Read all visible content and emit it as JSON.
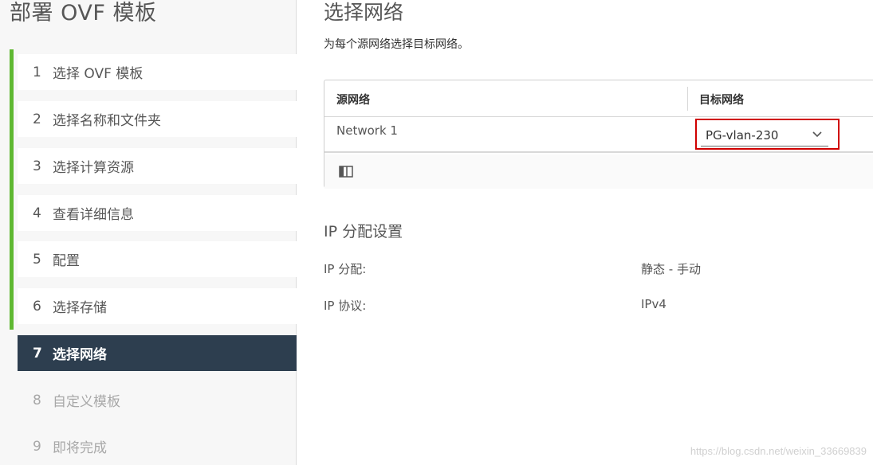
{
  "wizard": {
    "title": "部署 OVF 模板",
    "steps": [
      {
        "num": "1",
        "label": "选择 OVF 模板"
      },
      {
        "num": "2",
        "label": "选择名称和文件夹"
      },
      {
        "num": "3",
        "label": "选择计算资源"
      },
      {
        "num": "4",
        "label": "查看详细信息"
      },
      {
        "num": "5",
        "label": "配置"
      },
      {
        "num": "6",
        "label": "选择存储"
      },
      {
        "num": "7",
        "label": "选择网络"
      },
      {
        "num": "8",
        "label": "自定义模板"
      },
      {
        "num": "9",
        "label": "即将完成"
      }
    ]
  },
  "main": {
    "title": "选择网络",
    "description": "为每个源网络选择目标网络。",
    "grid": {
      "columns": [
        "源网络",
        "目标网络"
      ],
      "rows": [
        {
          "source": "Network 1",
          "target": "PG-vlan-230"
        }
      ],
      "footer_icon": "column-toggle-icon"
    },
    "ip_section": {
      "title": "IP 分配设置",
      "items": [
        {
          "label": "IP 分配:",
          "value": "静态 - 手动"
        },
        {
          "label": "IP 协议:",
          "value": "IPv4"
        }
      ]
    }
  },
  "watermark": "https://blog.csdn.net/weixin_33669839",
  "colors": {
    "progress": "#5fb832",
    "active_step": "#2d3e4f",
    "highlight_box": "#d00000"
  }
}
